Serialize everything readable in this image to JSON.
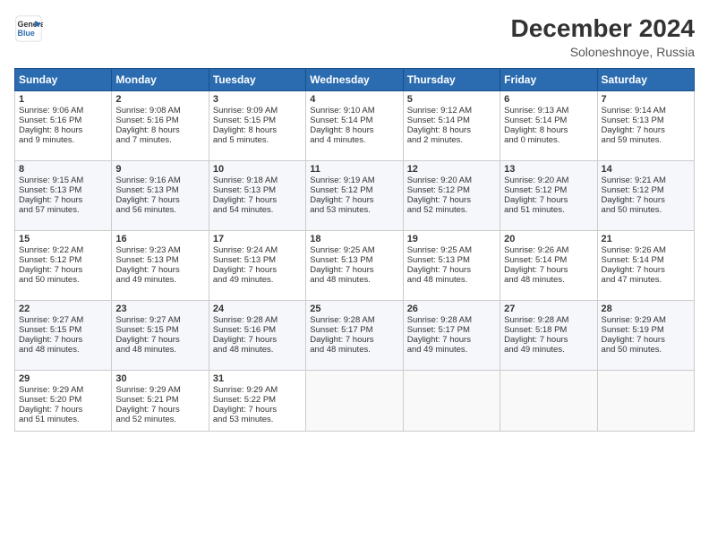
{
  "logo": {
    "line1": "General",
    "line2": "Blue"
  },
  "title": "December 2024",
  "subtitle": "Soloneshnoye, Russia",
  "days_header": [
    "Sunday",
    "Monday",
    "Tuesday",
    "Wednesday",
    "Thursday",
    "Friday",
    "Saturday"
  ],
  "weeks": [
    [
      {
        "day": "1",
        "lines": [
          "Sunrise: 9:06 AM",
          "Sunset: 5:16 PM",
          "Daylight: 8 hours",
          "and 9 minutes."
        ]
      },
      {
        "day": "2",
        "lines": [
          "Sunrise: 9:08 AM",
          "Sunset: 5:16 PM",
          "Daylight: 8 hours",
          "and 7 minutes."
        ]
      },
      {
        "day": "3",
        "lines": [
          "Sunrise: 9:09 AM",
          "Sunset: 5:15 PM",
          "Daylight: 8 hours",
          "and 5 minutes."
        ]
      },
      {
        "day": "4",
        "lines": [
          "Sunrise: 9:10 AM",
          "Sunset: 5:14 PM",
          "Daylight: 8 hours",
          "and 4 minutes."
        ]
      },
      {
        "day": "5",
        "lines": [
          "Sunrise: 9:12 AM",
          "Sunset: 5:14 PM",
          "Daylight: 8 hours",
          "and 2 minutes."
        ]
      },
      {
        "day": "6",
        "lines": [
          "Sunrise: 9:13 AM",
          "Sunset: 5:14 PM",
          "Daylight: 8 hours",
          "and 0 minutes."
        ]
      },
      {
        "day": "7",
        "lines": [
          "Sunrise: 9:14 AM",
          "Sunset: 5:13 PM",
          "Daylight: 7 hours",
          "and 59 minutes."
        ]
      }
    ],
    [
      {
        "day": "8",
        "lines": [
          "Sunrise: 9:15 AM",
          "Sunset: 5:13 PM",
          "Daylight: 7 hours",
          "and 57 minutes."
        ]
      },
      {
        "day": "9",
        "lines": [
          "Sunrise: 9:16 AM",
          "Sunset: 5:13 PM",
          "Daylight: 7 hours",
          "and 56 minutes."
        ]
      },
      {
        "day": "10",
        "lines": [
          "Sunrise: 9:18 AM",
          "Sunset: 5:13 PM",
          "Daylight: 7 hours",
          "and 54 minutes."
        ]
      },
      {
        "day": "11",
        "lines": [
          "Sunrise: 9:19 AM",
          "Sunset: 5:12 PM",
          "Daylight: 7 hours",
          "and 53 minutes."
        ]
      },
      {
        "day": "12",
        "lines": [
          "Sunrise: 9:20 AM",
          "Sunset: 5:12 PM",
          "Daylight: 7 hours",
          "and 52 minutes."
        ]
      },
      {
        "day": "13",
        "lines": [
          "Sunrise: 9:20 AM",
          "Sunset: 5:12 PM",
          "Daylight: 7 hours",
          "and 51 minutes."
        ]
      },
      {
        "day": "14",
        "lines": [
          "Sunrise: 9:21 AM",
          "Sunset: 5:12 PM",
          "Daylight: 7 hours",
          "and 50 minutes."
        ]
      }
    ],
    [
      {
        "day": "15",
        "lines": [
          "Sunrise: 9:22 AM",
          "Sunset: 5:12 PM",
          "Daylight: 7 hours",
          "and 50 minutes."
        ]
      },
      {
        "day": "16",
        "lines": [
          "Sunrise: 9:23 AM",
          "Sunset: 5:13 PM",
          "Daylight: 7 hours",
          "and 49 minutes."
        ]
      },
      {
        "day": "17",
        "lines": [
          "Sunrise: 9:24 AM",
          "Sunset: 5:13 PM",
          "Daylight: 7 hours",
          "and 49 minutes."
        ]
      },
      {
        "day": "18",
        "lines": [
          "Sunrise: 9:25 AM",
          "Sunset: 5:13 PM",
          "Daylight: 7 hours",
          "and 48 minutes."
        ]
      },
      {
        "day": "19",
        "lines": [
          "Sunrise: 9:25 AM",
          "Sunset: 5:13 PM",
          "Daylight: 7 hours",
          "and 48 minutes."
        ]
      },
      {
        "day": "20",
        "lines": [
          "Sunrise: 9:26 AM",
          "Sunset: 5:14 PM",
          "Daylight: 7 hours",
          "and 48 minutes."
        ]
      },
      {
        "day": "21",
        "lines": [
          "Sunrise: 9:26 AM",
          "Sunset: 5:14 PM",
          "Daylight: 7 hours",
          "and 47 minutes."
        ]
      }
    ],
    [
      {
        "day": "22",
        "lines": [
          "Sunrise: 9:27 AM",
          "Sunset: 5:15 PM",
          "Daylight: 7 hours",
          "and 48 minutes."
        ]
      },
      {
        "day": "23",
        "lines": [
          "Sunrise: 9:27 AM",
          "Sunset: 5:15 PM",
          "Daylight: 7 hours",
          "and 48 minutes."
        ]
      },
      {
        "day": "24",
        "lines": [
          "Sunrise: 9:28 AM",
          "Sunset: 5:16 PM",
          "Daylight: 7 hours",
          "and 48 minutes."
        ]
      },
      {
        "day": "25",
        "lines": [
          "Sunrise: 9:28 AM",
          "Sunset: 5:17 PM",
          "Daylight: 7 hours",
          "and 48 minutes."
        ]
      },
      {
        "day": "26",
        "lines": [
          "Sunrise: 9:28 AM",
          "Sunset: 5:17 PM",
          "Daylight: 7 hours",
          "and 49 minutes."
        ]
      },
      {
        "day": "27",
        "lines": [
          "Sunrise: 9:28 AM",
          "Sunset: 5:18 PM",
          "Daylight: 7 hours",
          "and 49 minutes."
        ]
      },
      {
        "day": "28",
        "lines": [
          "Sunrise: 9:29 AM",
          "Sunset: 5:19 PM",
          "Daylight: 7 hours",
          "and 50 minutes."
        ]
      }
    ],
    [
      {
        "day": "29",
        "lines": [
          "Sunrise: 9:29 AM",
          "Sunset: 5:20 PM",
          "Daylight: 7 hours",
          "and 51 minutes."
        ]
      },
      {
        "day": "30",
        "lines": [
          "Sunrise: 9:29 AM",
          "Sunset: 5:21 PM",
          "Daylight: 7 hours",
          "and 52 minutes."
        ]
      },
      {
        "day": "31",
        "lines": [
          "Sunrise: 9:29 AM",
          "Sunset: 5:22 PM",
          "Daylight: 7 hours",
          "and 53 minutes."
        ]
      },
      null,
      null,
      null,
      null
    ]
  ]
}
